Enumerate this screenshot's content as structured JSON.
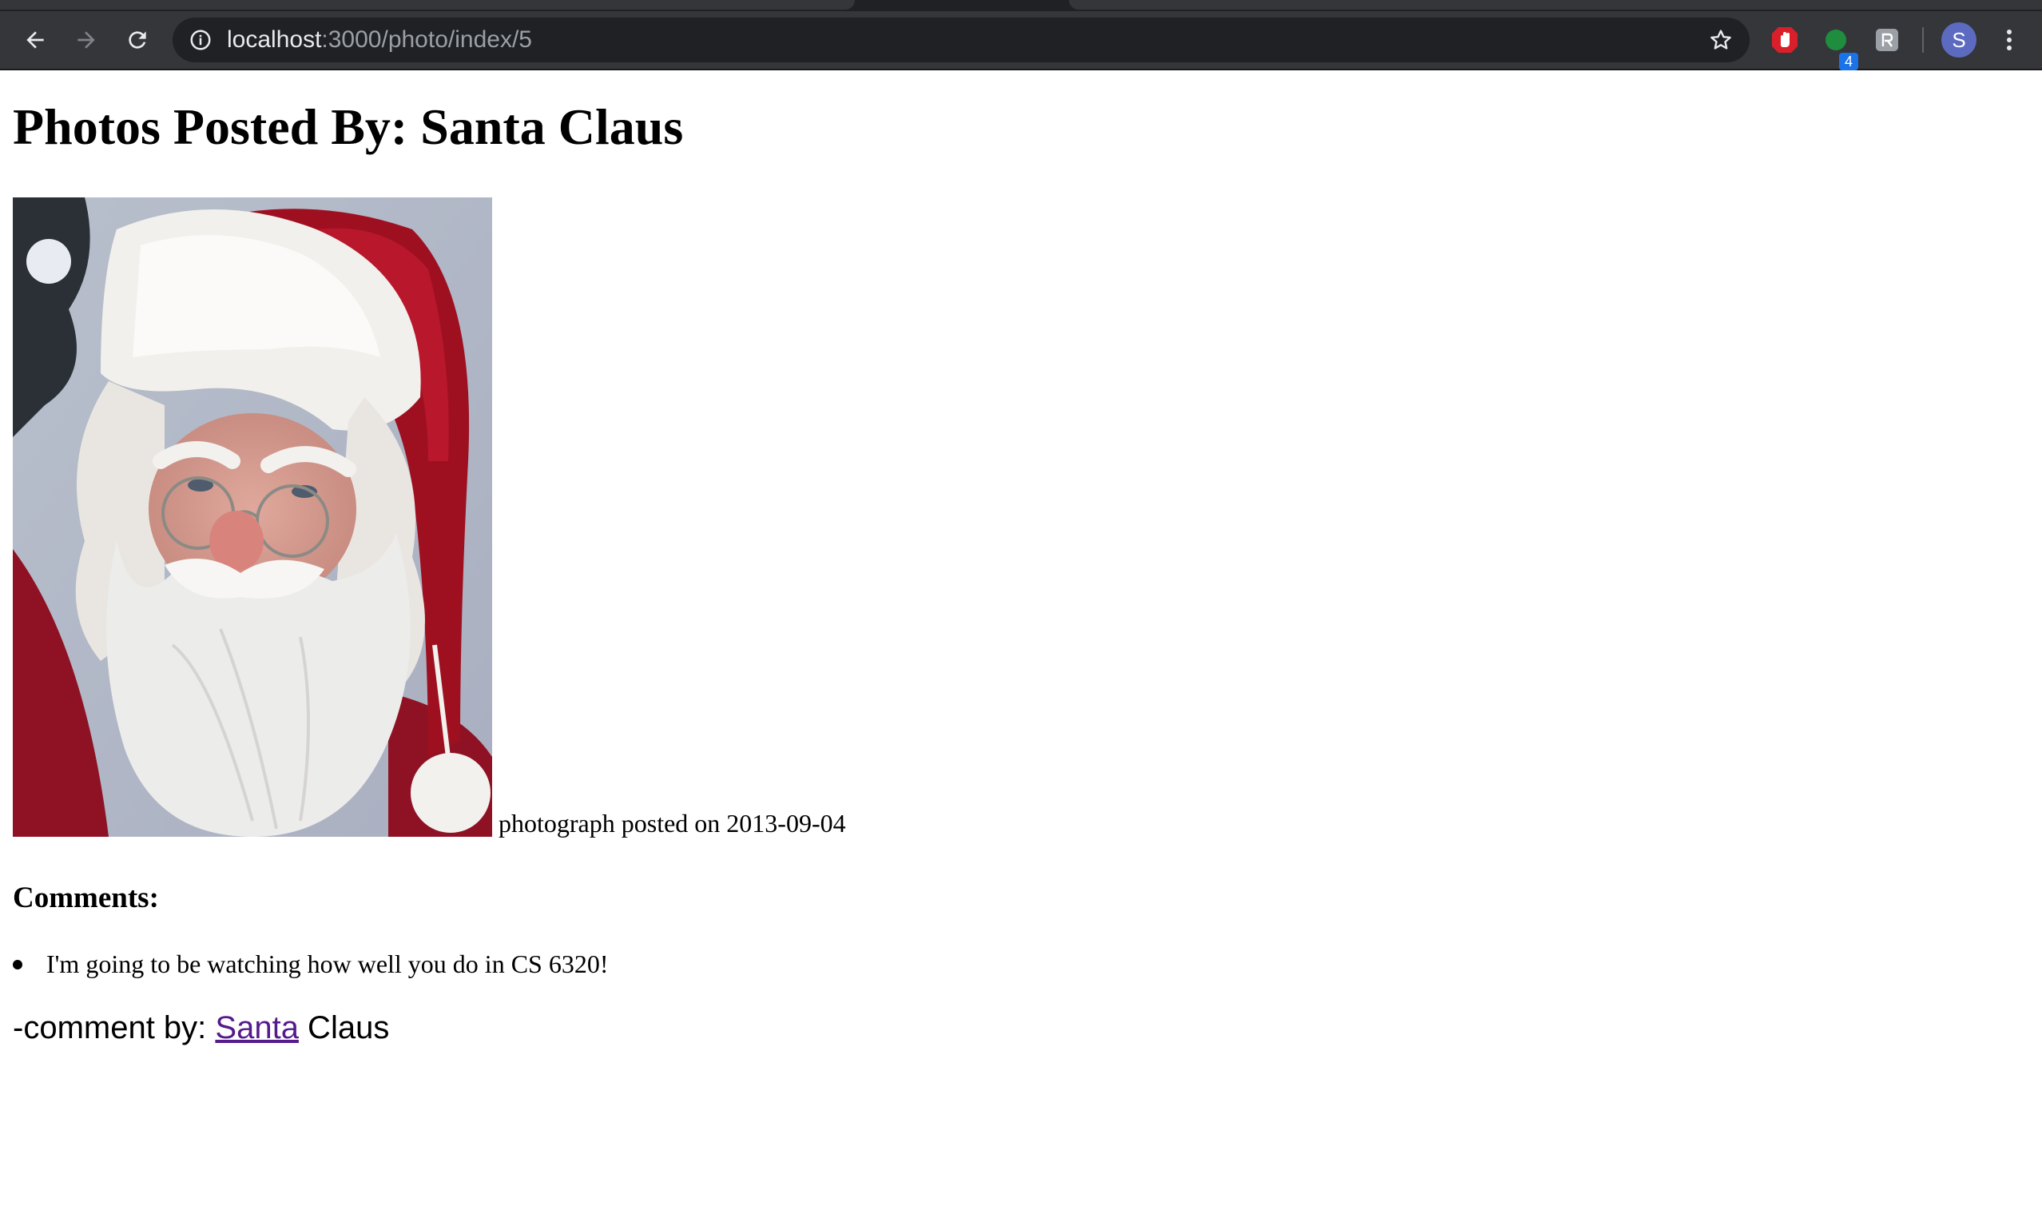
{
  "browser": {
    "url_host": "localhost",
    "url_rest": ":3000/photo/index/5",
    "extension_badge": "4",
    "profile_initial": "S",
    "accent_colors": {
      "toolbar": "#35363a",
      "omnibox": "#202124",
      "visited_link": "#551a8b",
      "badge": "#1a73e8"
    }
  },
  "page": {
    "heading": "Photos Posted By: Santa Claus",
    "photo": {
      "subject": "Santa Claus portrait",
      "caption": "photograph posted on 2013-09-04"
    },
    "comments_heading": "Comments:",
    "comments": [
      {
        "text": "I'm going to be watching how well you do in CS 6320!",
        "byline_prefix": "-comment by: ",
        "author_first": "Santa",
        "author_last": " Claus"
      }
    ]
  }
}
